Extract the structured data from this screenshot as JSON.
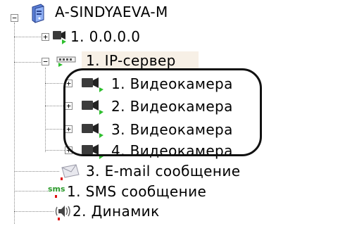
{
  "tree": {
    "root": {
      "label": "A-SINDYAEVA-M",
      "toggle": "−"
    },
    "nodes": [
      {
        "label": "1. 0.0.0.0",
        "toggle": "+",
        "icon": "camera-icon"
      },
      {
        "label": "1. IP-сервер",
        "toggle": "−",
        "icon": "ip-server-icon"
      },
      {
        "label": "1. Видеокамера",
        "toggle": "+",
        "icon": "camera-icon"
      },
      {
        "label": "2. Видеокамера",
        "toggle": "+",
        "icon": "camera-icon"
      },
      {
        "label": "3. Видеокамера",
        "toggle": "+",
        "icon": "camera-icon"
      },
      {
        "label": "4. Видеокамера",
        "toggle": "+",
        "icon": "camera-icon"
      },
      {
        "label": "3. E-mail сообщение",
        "icon": "email-icon"
      },
      {
        "label": "1. SMS сообщение",
        "icon": "sms-icon",
        "icon_text": "sms"
      },
      {
        "label": "2. Динамик",
        "icon": "speaker-icon"
      }
    ]
  },
  "colors": {
    "status_green": "#2fbf2f",
    "status_red": "#e01010",
    "selection_bg": "#f7f0e6",
    "sms_green": "#2a9a2a"
  }
}
